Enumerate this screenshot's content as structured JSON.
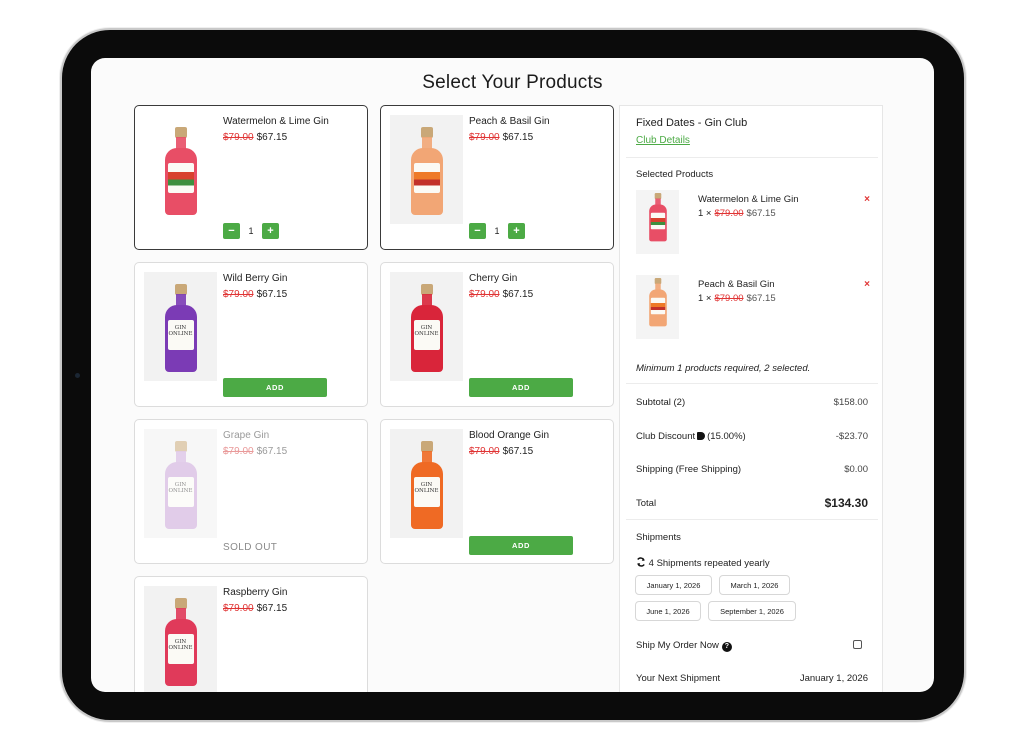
{
  "page": {
    "title": "Select Your Products"
  },
  "products": [
    {
      "name": "Watermelon & Lime Gin",
      "old_price": "$79.00",
      "price": "$67.15",
      "qty": "1",
      "minus": "−",
      "plus": "+",
      "bottle_color": "#e84e66",
      "state": "selected"
    },
    {
      "name": "Peach & Basil Gin",
      "old_price": "$79.00",
      "price": "$67.15",
      "qty": "1",
      "minus": "−",
      "plus": "+",
      "bottle_color": "#f2a675",
      "state": "selected"
    },
    {
      "name": "Wild Berry Gin",
      "old_price": "$79.00",
      "price": "$67.15",
      "add_label": "ADD",
      "bottle_color": "#7b3bb5",
      "label_text": "GIN ONLINE"
    },
    {
      "name": "Cherry Gin",
      "old_price": "$79.00",
      "price": "$67.15",
      "add_label": "ADD",
      "bottle_color": "#d9253a",
      "label_text": "GIN ONLINE"
    },
    {
      "name": "Grape Gin",
      "old_price": "$79.00",
      "price": "$67.15",
      "sold_out": "SOLD OUT",
      "bottle_color": "#c9a3d8",
      "label_text": "GIN ONLINE"
    },
    {
      "name": "Blood Orange Gin",
      "old_price": "$79.00",
      "price": "$67.15",
      "add_label": "ADD",
      "bottle_color": "#ef6a24",
      "label_text": "GIN ONLINE"
    },
    {
      "name": "Raspberry Gin",
      "old_price": "$79.00",
      "price": "$67.15",
      "bottle_color": "#e03a5a",
      "label_text": "GIN ONLINE"
    }
  ],
  "summary": {
    "title": "Fixed Dates - Gin Club",
    "club_link": "Club Details",
    "selected_heading": "Selected Products",
    "selected": [
      {
        "name": "Watermelon & Lime Gin",
        "qty": "1 ×",
        "old_price": "$79.00",
        "price": "$67.15",
        "remove": "×"
      },
      {
        "name": "Peach & Basil Gin",
        "qty": "1 ×",
        "old_price": "$79.00",
        "price": "$67.15",
        "remove": "×"
      }
    ],
    "min_note": "Minimum 1 products required, 2 selected.",
    "subtotal_label": "Subtotal (2)",
    "subtotal": "$158.00",
    "discount_label": "Club Discount",
    "discount_pct": "(15.00%)",
    "discount": "-$23.70",
    "shipping_label": "Shipping (Free Shipping)",
    "shipping": "$0.00",
    "total_label": "Total",
    "total": "$134.30",
    "shipments_heading": "Shipments",
    "repeat_text": "4 Shipments repeated yearly",
    "dates": [
      "January 1, 2026",
      "March 1, 2026",
      "June 1, 2026",
      "September 1, 2026"
    ],
    "ship_now_label": "Ship My Order Now",
    "help_glyph": "?",
    "next_label": "Your Next Shipment",
    "next_date": "January 1, 2026"
  },
  "icons": [
    "tag-icon",
    "repeat-icon",
    "help-icon",
    "remove-icon"
  ],
  "colors": {
    "accent": "#4caa45",
    "sale": "#e03434"
  }
}
